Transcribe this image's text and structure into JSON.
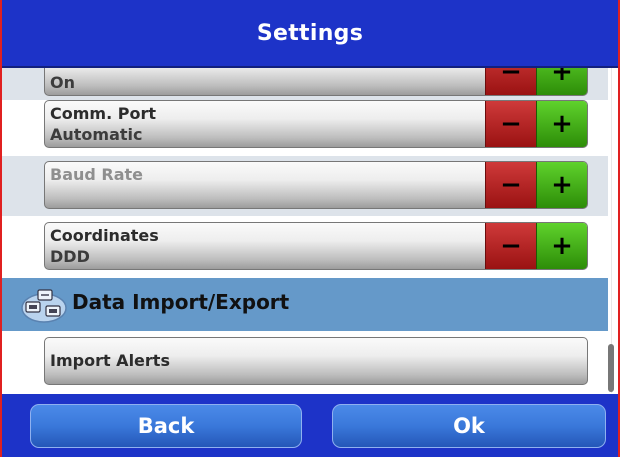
{
  "title": "Settings",
  "rows": [
    {
      "label": "",
      "value": "On",
      "disabled": false
    },
    {
      "label": "Comm. Port",
      "value": "Automatic",
      "disabled": false
    },
    {
      "label": "Baud Rate",
      "value": "",
      "disabled": true
    },
    {
      "label": "Coordinates",
      "value": "DDD",
      "disabled": false
    }
  ],
  "stepper": {
    "minus": "−",
    "plus": "+"
  },
  "section": {
    "title": "Data Import/Export",
    "icon": "data-transfer-icon"
  },
  "actions": [
    {
      "label": "Import Alerts"
    }
  ],
  "buttons": {
    "back": "Back",
    "ok": "Ok"
  },
  "colors": {
    "title_bar": "#1d33c8",
    "section_header": "#6599c9",
    "minus": "#b42020",
    "plus": "#3fa416"
  }
}
